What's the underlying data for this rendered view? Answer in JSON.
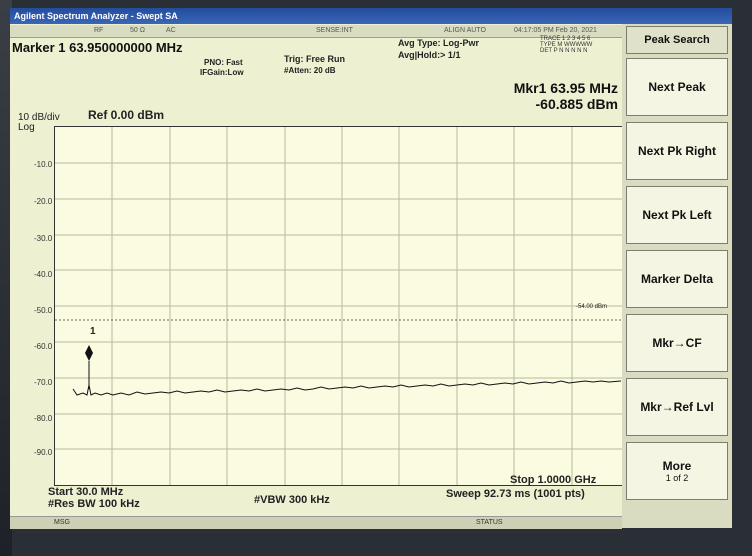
{
  "window": {
    "title": "Agilent Spectrum Analyzer - Swept SA"
  },
  "statusbar": {
    "rf": "RF",
    "impedance": "50 Ω",
    "coupling": "AC",
    "sense": "SENSE:INT",
    "align": "ALIGN AUTO",
    "clock": "04:17:05 PM Feb 20, 2021"
  },
  "trace_info": {
    "trace_label": "TRACE",
    "trace_nums": "1 2 3 4 5 6",
    "type_label": "TYPE",
    "type_val": "M WWWWW",
    "det_label": "DET",
    "det_val": "P N N N N N"
  },
  "marker": {
    "header": "Marker 1  63.950000000 MHz",
    "readout_freq": "Mkr1 63.95 MHz",
    "readout_amp": "-60.885 dBm",
    "label": "1"
  },
  "settings": {
    "pno": "PNO: Fast",
    "ifgain": "IFGain:Low",
    "trig": "Trig: Free Run",
    "atten": "#Atten: 20 dB",
    "avg_type": "Avg Type: Log-Pwr",
    "avg_hold": "Avg|Hold:> 1/1"
  },
  "scale": {
    "div": "10 dB/div",
    "log": "Log",
    "ref": "Ref 0.00 dBm",
    "threshold": "-54.00 dBm"
  },
  "yticks": [
    "-10.0",
    "-20.0",
    "-30.0",
    "-40.0",
    "-50.0",
    "-60.0",
    "-70.0",
    "-80.0",
    "-90.0"
  ],
  "footer": {
    "start": "Start 30.0 MHz",
    "rbw": "#Res BW 100 kHz",
    "vbw": "#VBW 300 kHz",
    "stop": "Stop 1.0000 GHz",
    "sweep": "Sweep  92.73 ms (1001 pts)",
    "msg": "MSG",
    "status": "STATUS"
  },
  "softkeys": [
    {
      "label": "Peak Search"
    },
    {
      "label": "Next Peak"
    },
    {
      "label": "Next Pk Right"
    },
    {
      "label": "Next Pk Left"
    },
    {
      "label": "Marker Delta"
    },
    {
      "label": "Mkr→CF"
    },
    {
      "label": "Mkr→Ref Lvl"
    },
    {
      "label": "More",
      "sub": "1 of 2"
    }
  ],
  "colors": {
    "background": "#eef0d2",
    "trace": "#111111",
    "title": "#234c9c"
  }
}
